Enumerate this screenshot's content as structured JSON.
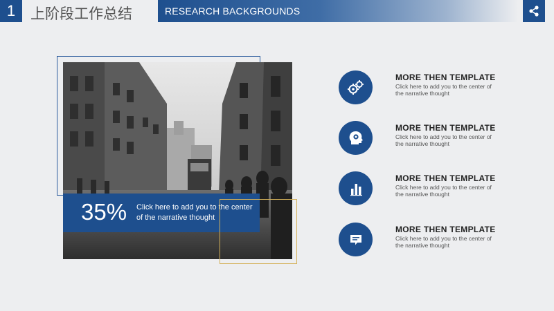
{
  "header": {
    "number": "1",
    "title": "上阶段工作总结",
    "subtitle": "RESEARCH BACKGROUNDS"
  },
  "share": {
    "icon": "share-icon"
  },
  "stat": {
    "value": "35%",
    "text": "Click here to add  you to the  center of the  narrative thought"
  },
  "photo": {
    "description_icon": "city-street-photo"
  },
  "features": [
    {
      "icon": "gears-icon",
      "title": "MORE  THEN  TEMPLATE",
      "desc": "Click here to add  you to the  center of the  narrative thought"
    },
    {
      "icon": "head-gear-icon",
      "title": "MORE  THEN  TEMPLATE",
      "desc": "Click here to add  you to the  center of the  narrative thought"
    },
    {
      "icon": "bar-chart-icon",
      "title": "MORE  THEN  TEMPLATE",
      "desc": "Click here to add  you to the  center of the  narrative thought"
    },
    {
      "icon": "chat-bubble-icon",
      "title": "MORE  THEN  TEMPLATE",
      "desc": "Click here to add  you to the  center of the  narrative thought"
    }
  ],
  "colors": {
    "accent": "#1e4f8e",
    "gold": "#d4b15a",
    "background": "#edeef0"
  }
}
